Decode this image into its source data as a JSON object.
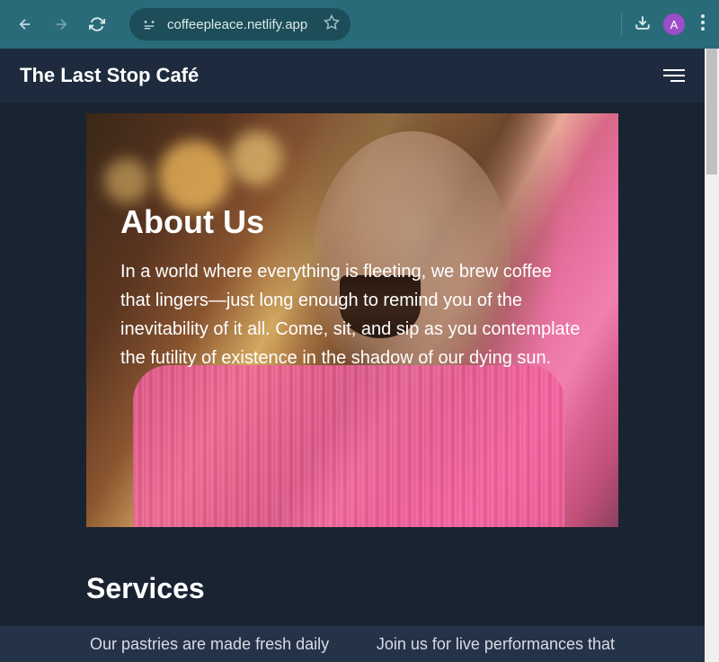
{
  "browser": {
    "url": "coffeepleace.netlify.app",
    "avatar_letter": "A"
  },
  "header": {
    "title": "The Last Stop Café"
  },
  "hero": {
    "heading": "About Us",
    "body": "In a world where everything is fleeting, we brew coffee that lingers—just long enough to remind you of the inevitability of it all. Come, sit, and sip as you contemplate the futility of existence in the shadow of our dying sun."
  },
  "services": {
    "heading": "Services",
    "items": [
      "Our pastries are made fresh daily",
      "Join us for live performances that"
    ]
  }
}
